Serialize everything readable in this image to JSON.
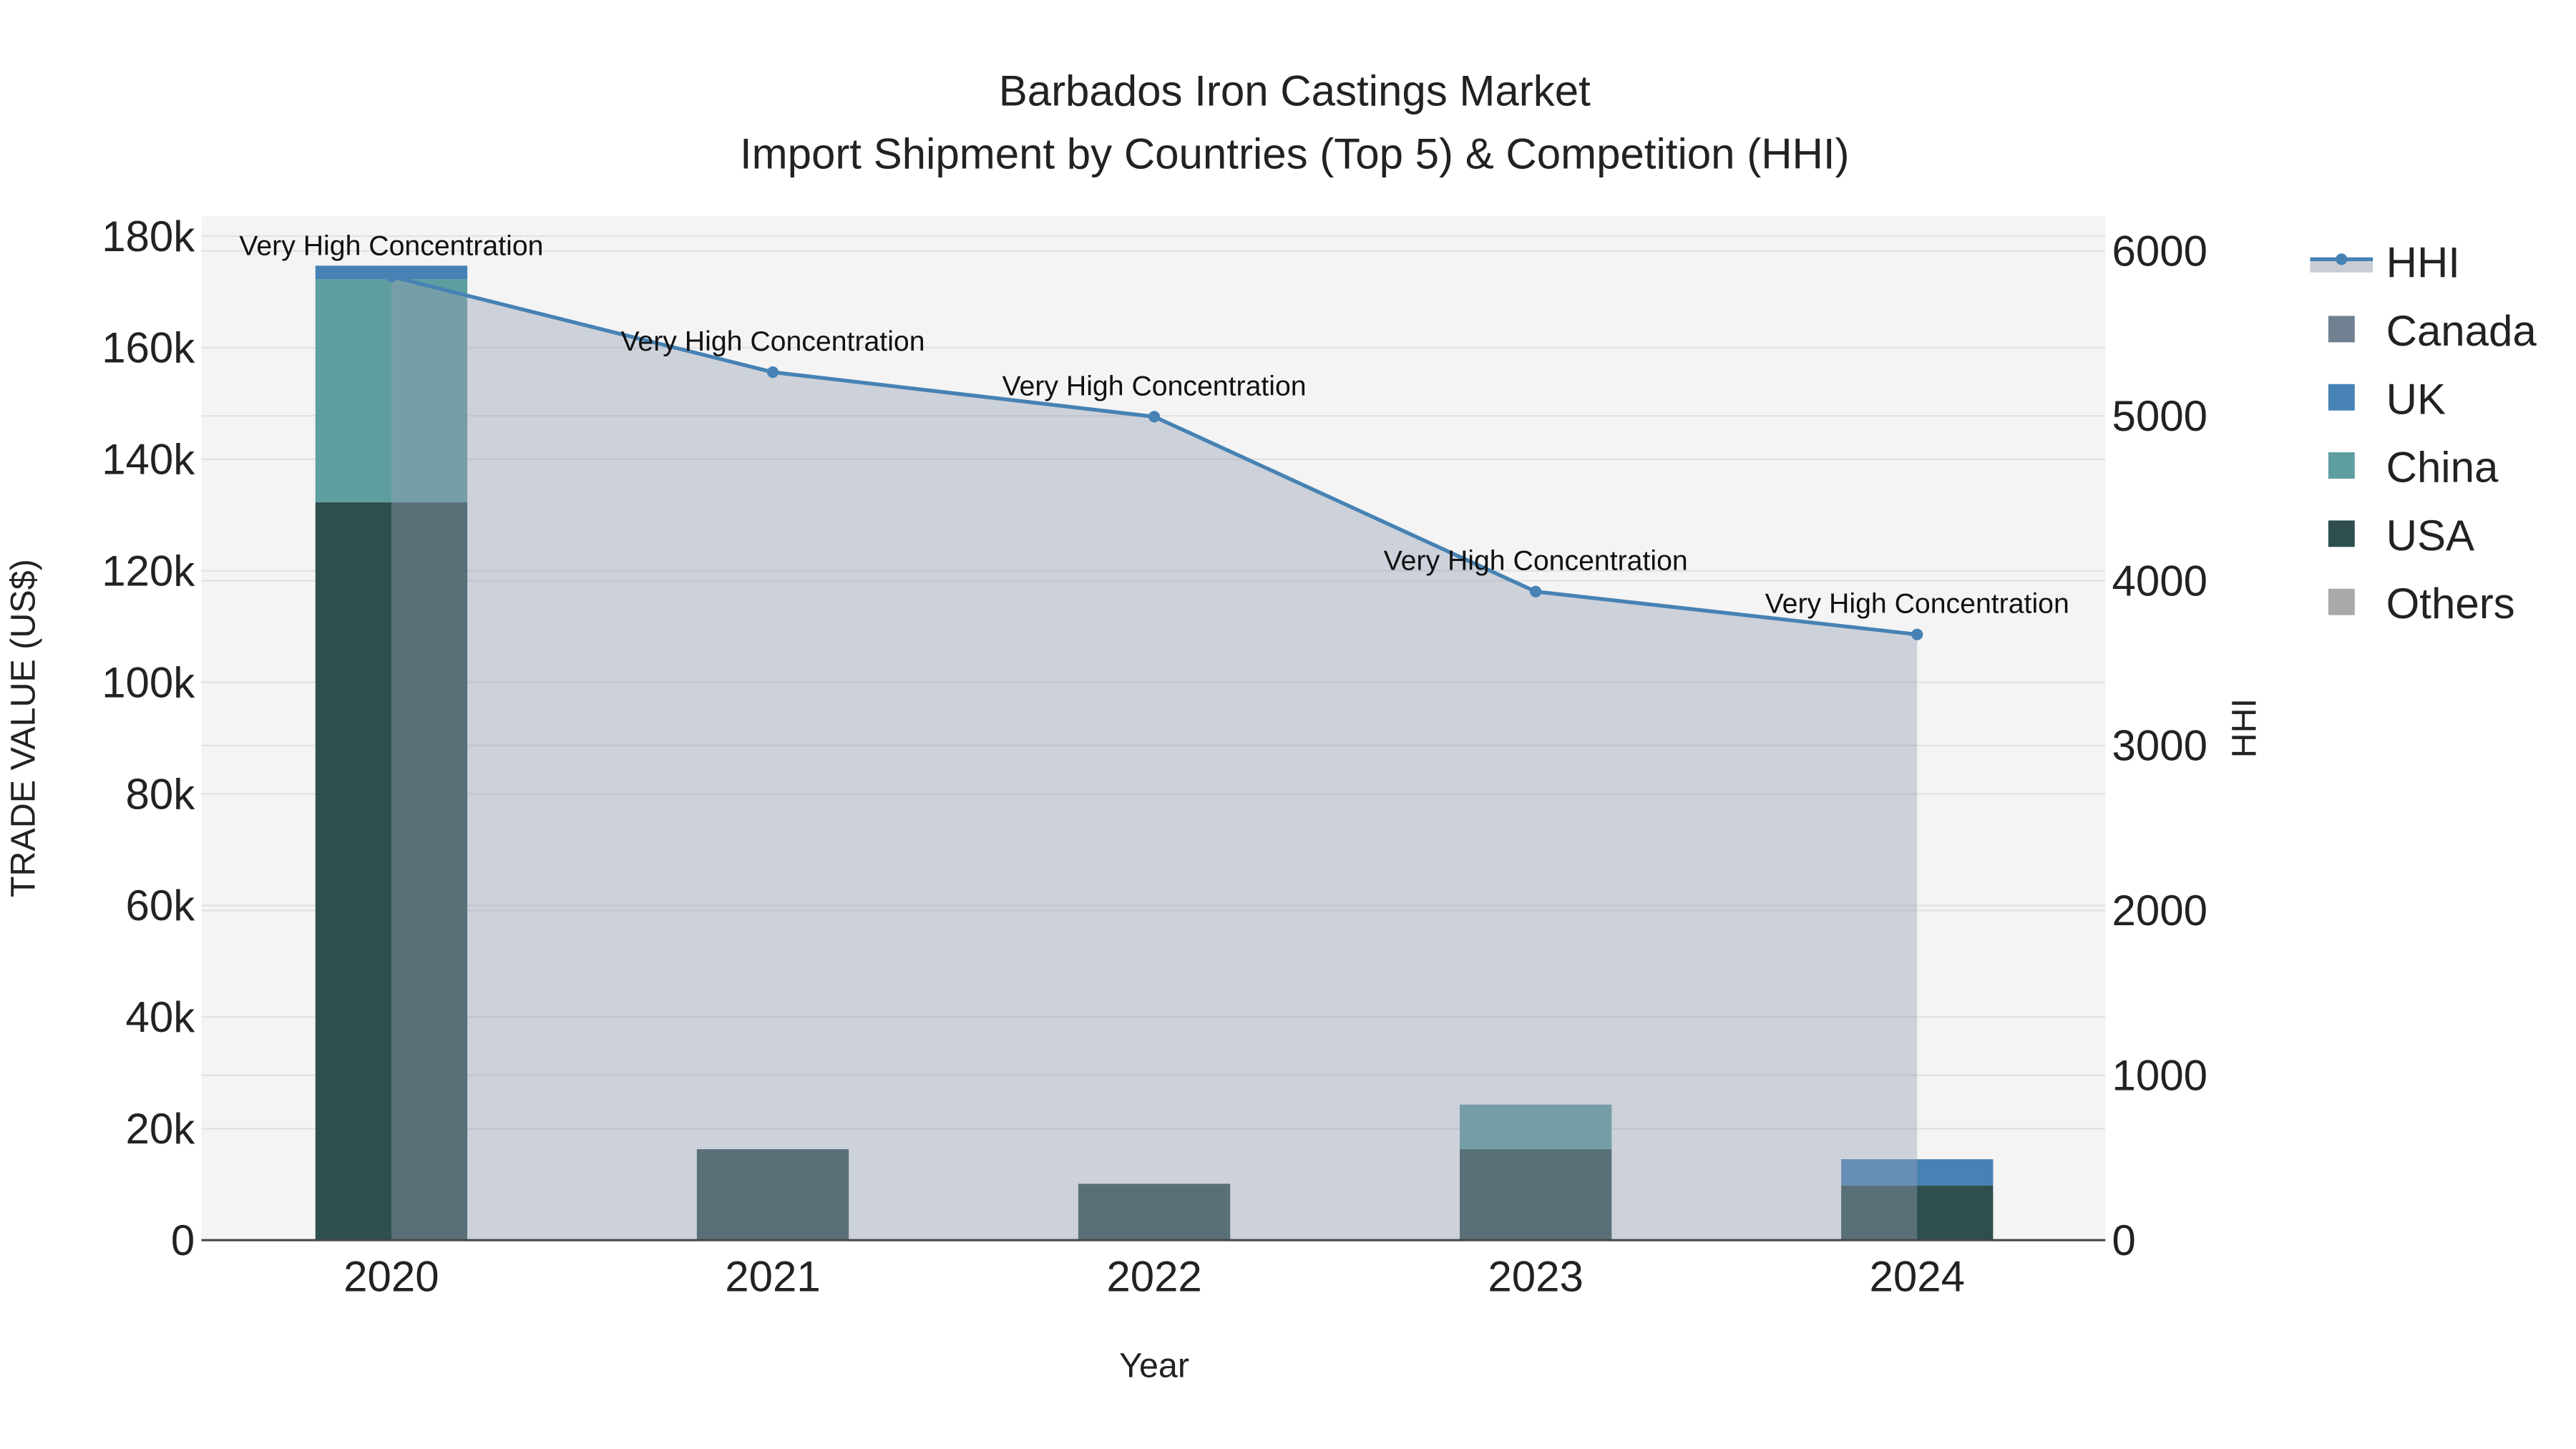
{
  "chart_data": {
    "type": "bar",
    "title": "Barbados Iron Castings Market",
    "subtitle": "Import Shipment by Countries (Top 5) & Competition (HHI)",
    "xlabel": "Year",
    "ylabel": "TRADE VALUE (US$)",
    "y2label": "HHI",
    "categories": [
      "2020",
      "2021",
      "2022",
      "2023",
      "2024"
    ],
    "ylim": [
      0,
      180000
    ],
    "y2lim": [
      0,
      6000
    ],
    "yticks": [
      0,
      20000,
      40000,
      60000,
      80000,
      100000,
      120000,
      140000,
      160000,
      180000
    ],
    "ytick_labels": [
      "0",
      "20k",
      "40k",
      "60k",
      "80k",
      "100k",
      "120k",
      "140k",
      "160k",
      "180k"
    ],
    "y2ticks": [
      0,
      1000,
      2000,
      3000,
      4000,
      5000,
      6000
    ],
    "y2tick_labels": [
      "0",
      "1000",
      "2000",
      "3000",
      "4000",
      "5000",
      "6000"
    ],
    "grid": true,
    "barmode": "stack",
    "series": [
      {
        "name": "USA",
        "color": "#2f4f4f",
        "values": [
          132300,
          16300,
          10100,
          16300,
          9800
        ]
      },
      {
        "name": "China",
        "color": "#5f9ea0",
        "values": [
          40000,
          0,
          0,
          8000,
          0
        ]
      },
      {
        "name": "UK",
        "color": "#4682b4",
        "values": [
          2400,
          0,
          0,
          0,
          4700
        ]
      },
      {
        "name": "Canada",
        "color": "#708090",
        "values": [
          0,
          0,
          0,
          0,
          0
        ]
      },
      {
        "name": "Others",
        "color": "#a9a9a9",
        "values": [
          0,
          0,
          0,
          0,
          0
        ]
      }
    ],
    "hhi": {
      "name": "HHI",
      "color": "#4682b4",
      "values": [
        5845,
        5265,
        4995,
        3934,
        3674
      ],
      "annotations": [
        "Very High Concentration",
        "Very High Concentration",
        "Very High Concentration",
        "Very High Concentration",
        "Very High Concentration"
      ]
    },
    "legend": {
      "placement": "right",
      "items": [
        "HHI",
        "Canada",
        "UK",
        "China",
        "USA",
        "Others"
      ]
    }
  }
}
